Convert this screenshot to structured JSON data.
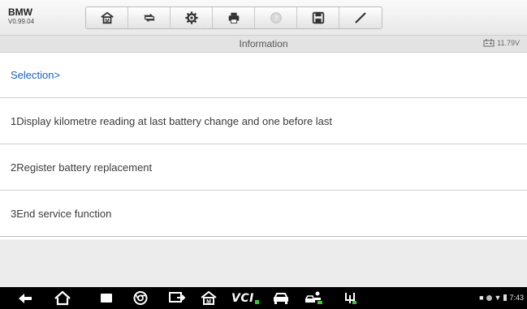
{
  "header": {
    "app_name": "BMW",
    "version": "V0.99.04",
    "toolbar_buttons": [
      {
        "icon": "home-icon"
      },
      {
        "icon": "vehicle-swap-icon"
      },
      {
        "icon": "settings-gear-icon"
      },
      {
        "icon": "printer-icon"
      },
      {
        "icon": "help-icon"
      },
      {
        "icon": "save-icon"
      },
      {
        "icon": "pen-icon"
      }
    ]
  },
  "infobar": {
    "title": "Information",
    "voltage": "11.79V"
  },
  "list": {
    "heading": "Selection>",
    "items": [
      "1Display kilometre reading at last battery change and one before last",
      "2Register battery replacement",
      "3End service function"
    ]
  },
  "navbar": {
    "vci_label": "VCI",
    "clock": "7:43",
    "icons": [
      "back-icon",
      "home-icon",
      "recent-apps-icon",
      "chrome-icon",
      "screen-share-icon",
      "maxisys-home-icon",
      "vci-icon",
      "car-icon",
      "car-service-icon",
      "usb-icon"
    ]
  },
  "colors": {
    "heading_text": "#1a5fc4",
    "list_text": "#3a3a3a",
    "navbar_bg": "#000000"
  }
}
